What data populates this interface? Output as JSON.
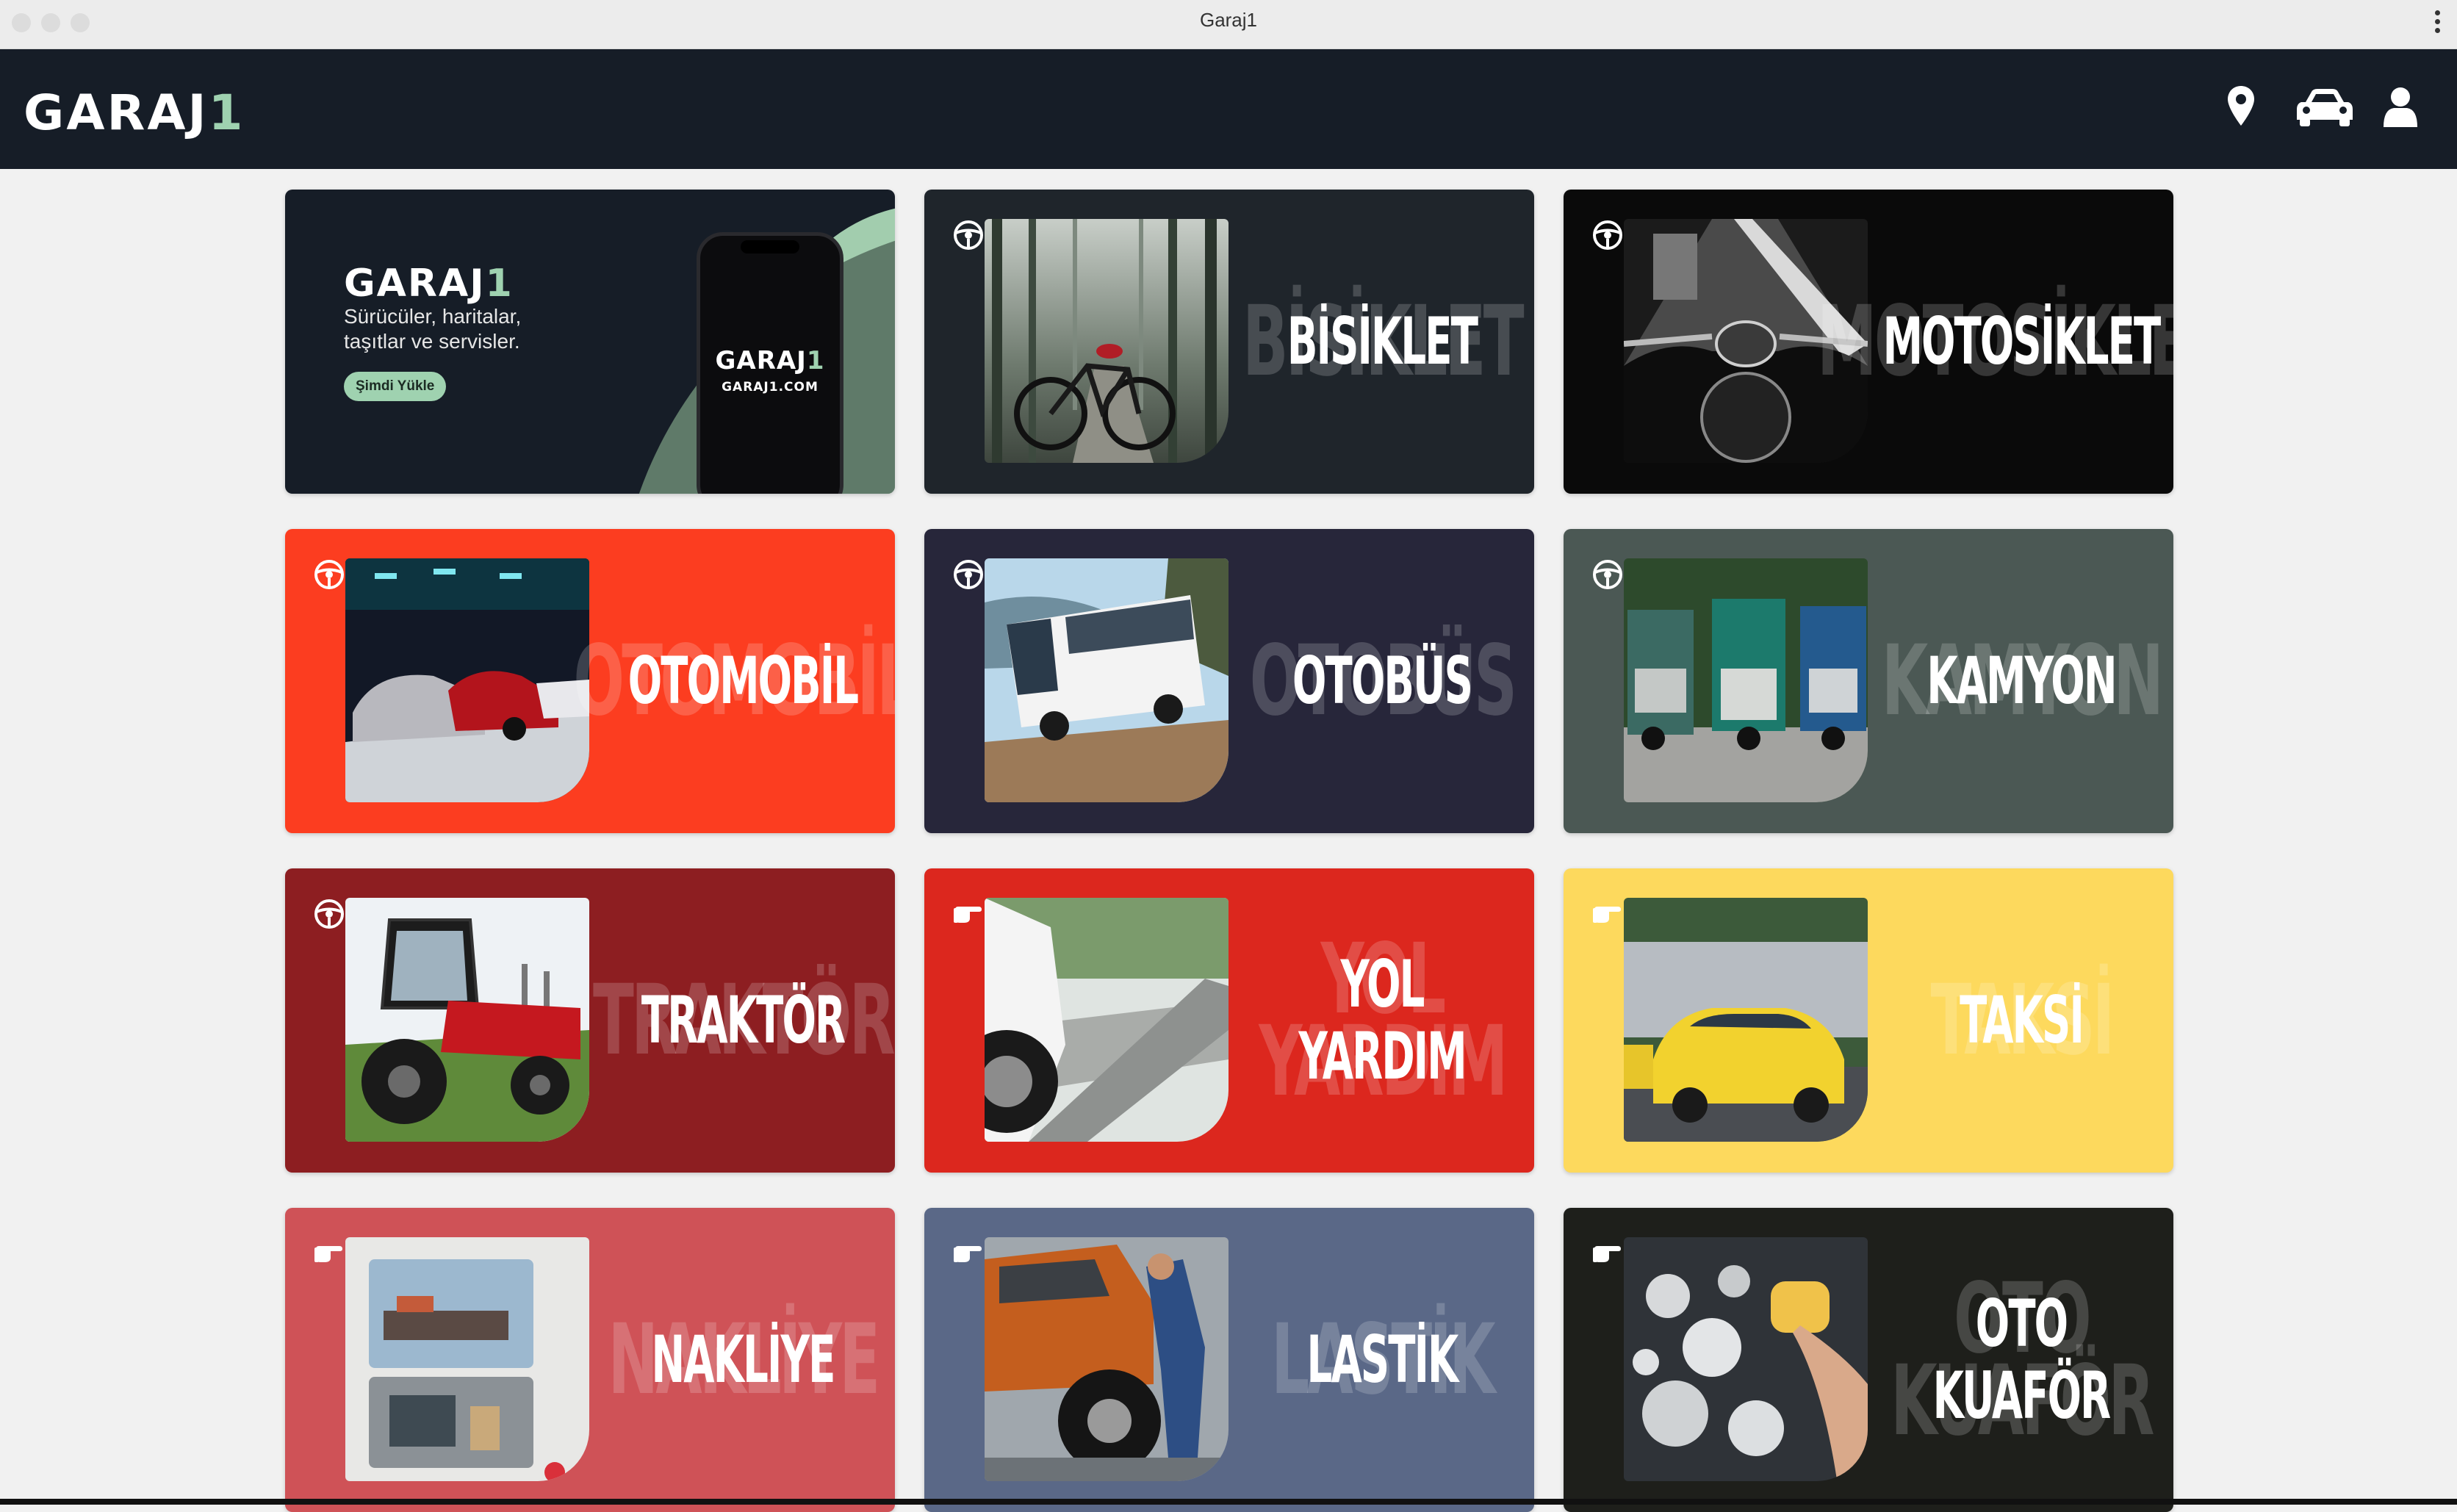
{
  "window": {
    "title": "Garaj1"
  },
  "header": {
    "logo_main": "GARAJ",
    "logo_accent": "1",
    "icons": [
      "location-pin-icon",
      "car-icon",
      "user-icon"
    ]
  },
  "promo": {
    "logo_main": "GARAJ",
    "logo_accent": "1",
    "text": "Sürücüler, haritalar, taşıtlar ve servisler.",
    "button_label": "Şimdi Yükle",
    "phone_logo_main": "GARAJ",
    "phone_logo_accent": "1",
    "phone_url": "GARAJ1.COM"
  },
  "categories": [
    {
      "label": "BİSİKLET",
      "ghost": "BİSİKLET",
      "color": "#1f252b",
      "badge": "steering-wheel-icon"
    },
    {
      "label": "MOTOSİKLET",
      "ghost": "MOTOSİKLET",
      "color": "#0a0a0a",
      "badge": "steering-wheel-icon"
    },
    {
      "label": "OTOMOBİL",
      "ghost": "OTOMOBİL",
      "color": "#fc3d20",
      "badge": "steering-wheel-icon"
    },
    {
      "label": "OTOBÜS",
      "ghost": "OTOBÜS",
      "color": "#27263a",
      "badge": "steering-wheel-icon"
    },
    {
      "label": "KAMYON",
      "ghost": "KAMYON",
      "color": "#4b5854",
      "badge": "steering-wheel-icon"
    },
    {
      "label": "TRAKTÖR",
      "ghost": "TRAKTÖR",
      "color": "#8d1e21",
      "badge": "steering-wheel-icon"
    },
    {
      "label": "YOL YARDIM",
      "ghost": "YOL\nYARDIM",
      "color": "#dc271e",
      "badge": "pointing-hand-icon"
    },
    {
      "label": "TAKSİ",
      "ghost": "TAKSİ",
      "color": "#fdd95d",
      "badge": "pointing-hand-icon"
    },
    {
      "label": "NAKLİYE",
      "ghost": "NAKLİYE",
      "color": "#cf5257",
      "badge": "pointing-hand-icon"
    },
    {
      "label": "LASTİK",
      "ghost": "LASTİK",
      "color": "#5a6887",
      "badge": "pointing-hand-icon"
    },
    {
      "label": "OTO\nKUAFÖR",
      "ghost": "OTO\nKUAFÖR",
      "color": "#1e1f1b",
      "badge": "pointing-hand-icon"
    }
  ]
}
